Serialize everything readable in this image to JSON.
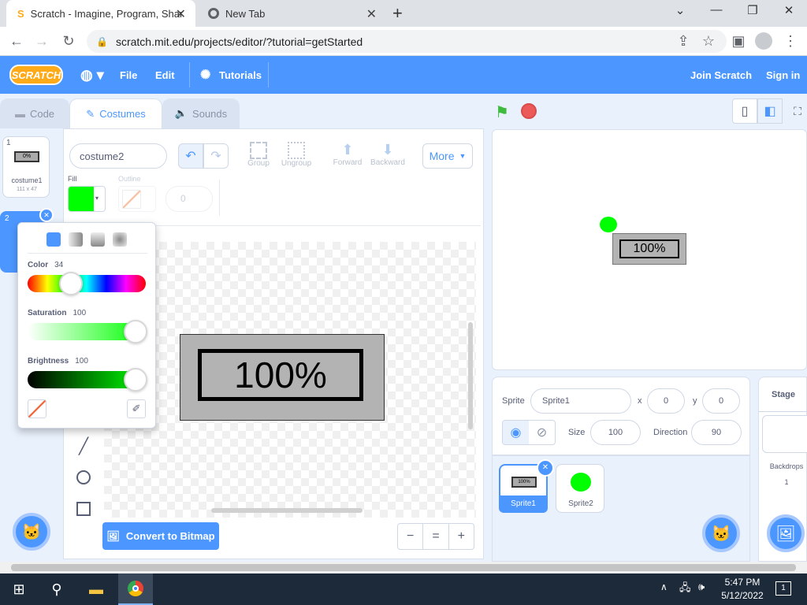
{
  "browser": {
    "tabs": [
      {
        "title": "Scratch - Imagine, Program, Shar",
        "close": "✕"
      },
      {
        "title": "New Tab",
        "close": "✕"
      }
    ],
    "new_tab": "+",
    "window_controls": {
      "minimize": "⌄",
      "min2": "—",
      "restore": "❐",
      "close": "✕"
    },
    "url": "scratch.mit.edu/projects/editor/?tutorial=getStarted"
  },
  "menubar": {
    "logo": "SCRATCH",
    "file": "File",
    "edit": "Edit",
    "tutorials": "Tutorials",
    "join": "Join Scratch",
    "signin": "Sign in",
    "accent": "#4c97ff"
  },
  "editor_tabs": {
    "code": "Code",
    "costumes": "Costumes",
    "sounds": "Sounds"
  },
  "costumes": [
    {
      "index": "1",
      "name": "costume1",
      "size": "111 x 47",
      "thumb": "0%"
    },
    {
      "index": "2",
      "name": "costume2",
      "size": "",
      "thumb": ""
    }
  ],
  "paint": {
    "costume_name": "costume2",
    "group": "Group",
    "ungroup": "Ungroup",
    "forward": "Forward",
    "backward": "Backward",
    "more": "More",
    "fill_label": "Fill",
    "outline_label": "Outline",
    "outline_width": "0",
    "fill_color": "#00ff00",
    "convert": "Convert to Bitmap",
    "canvas_text": "100%",
    "zoom_out": "−",
    "zoom_reset": "=",
    "zoom_in": "+"
  },
  "color_popup": {
    "color_label": "Color",
    "color_value": "34",
    "saturation_label": "Saturation",
    "saturation_value": "100",
    "brightness_label": "Brightness",
    "brightness_value": "100"
  },
  "stage": {
    "sprite_text": "100%"
  },
  "sprite_info": {
    "sprite_label": "Sprite",
    "sprite_name": "Sprite1",
    "x_label": "x",
    "x_value": "0",
    "y_label": "y",
    "y_value": "0",
    "size_label": "Size",
    "size_value": "100",
    "direction_label": "Direction",
    "direction_value": "90"
  },
  "sprites": [
    {
      "name": "Sprite1",
      "thumb": "100%"
    },
    {
      "name": "Sprite2"
    }
  ],
  "stage_panel": {
    "title": "Stage",
    "backdrops_label": "Backdrops",
    "backdrops_count": "1"
  },
  "taskbar": {
    "time": "5:47 PM",
    "date": "5/12/2022",
    "notif": "1"
  }
}
